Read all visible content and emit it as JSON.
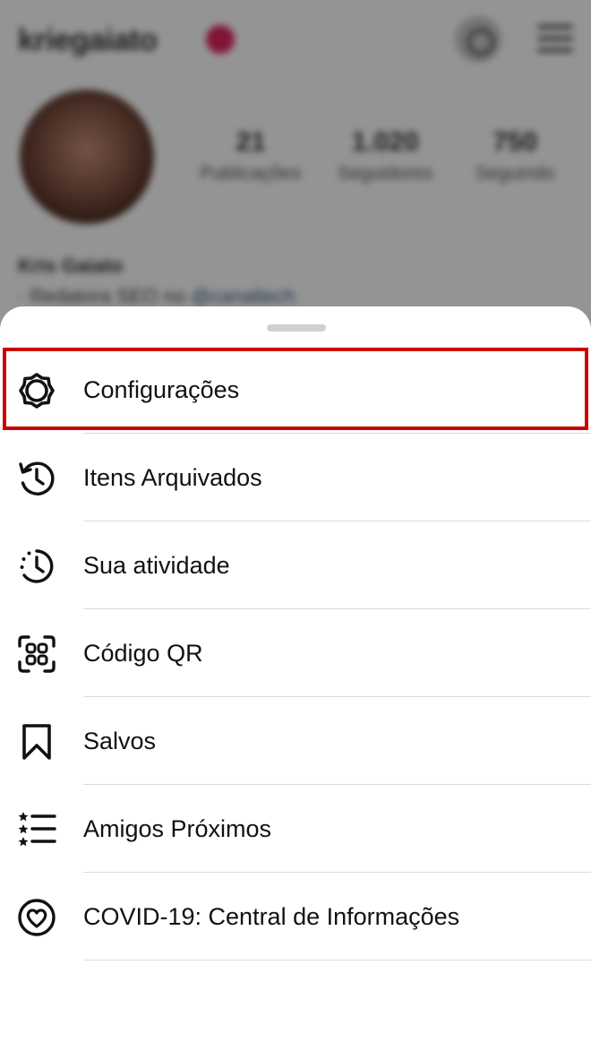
{
  "background_profile": {
    "username": "kriegaiato",
    "stats": [
      {
        "value": "21",
        "label": "Publicações"
      },
      {
        "value": "1.020",
        "label": "Seguidores"
      },
      {
        "value": "750",
        "label": "Seguindo"
      }
    ],
    "name": "Kris Gaiato",
    "bio_prefix": "· Redatora SEO no ",
    "bio_mention": "@canaltech"
  },
  "menu": {
    "items": [
      {
        "label": "Configurações",
        "icon": "gear-icon",
        "highlighted": true
      },
      {
        "label": "Itens Arquivados",
        "icon": "archive-history-icon"
      },
      {
        "label": "Sua atividade",
        "icon": "activity-clock-icon"
      },
      {
        "label": "Código QR",
        "icon": "qr-code-icon"
      },
      {
        "label": "Salvos",
        "icon": "bookmark-icon"
      },
      {
        "label": "Amigos Próximos",
        "icon": "close-friends-list-icon"
      },
      {
        "label": "COVID-19: Central de Informações",
        "icon": "covid-info-heart-icon"
      }
    ]
  },
  "colors": {
    "highlight": "#cc0000",
    "overlay": "rgba(0,0,0,0.42)",
    "text": "#111111",
    "mention": "#375a8e"
  }
}
